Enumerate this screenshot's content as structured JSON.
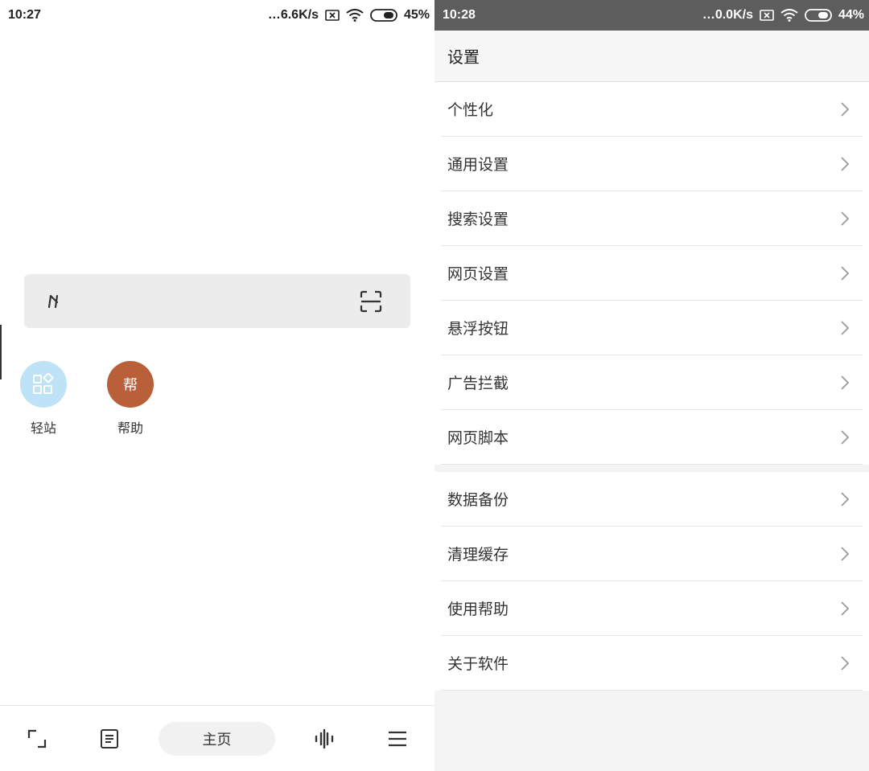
{
  "left": {
    "status": {
      "time": "10:27",
      "speed": "6.6K/s",
      "battery": "45%"
    },
    "search": {
      "logo_icon": "h-logo-icon",
      "scan_icon": "scan-icon"
    },
    "shortcuts": [
      {
        "label": "轻站",
        "icon": "grid-apps-icon",
        "color": "#bfe3f6"
      },
      {
        "label": "帮助",
        "glyph": "帮",
        "color": "#b9603a"
      }
    ],
    "bottom_nav": {
      "tabs_icon": "tabs-corner-icon",
      "reader_icon": "reader-icon",
      "home_label": "主页",
      "voice_icon": "voice-wave-icon",
      "menu_icon": "menu-icon"
    }
  },
  "right": {
    "status": {
      "time": "10:28",
      "speed": "0.0K/s",
      "battery": "44%"
    },
    "title": "设置",
    "groups": [
      [
        "个性化",
        "通用设置",
        "搜索设置",
        "网页设置",
        "悬浮按钮",
        "广告拦截",
        "网页脚本"
      ],
      [
        "数据备份",
        "清理缓存",
        "使用帮助",
        "关于软件"
      ]
    ]
  }
}
